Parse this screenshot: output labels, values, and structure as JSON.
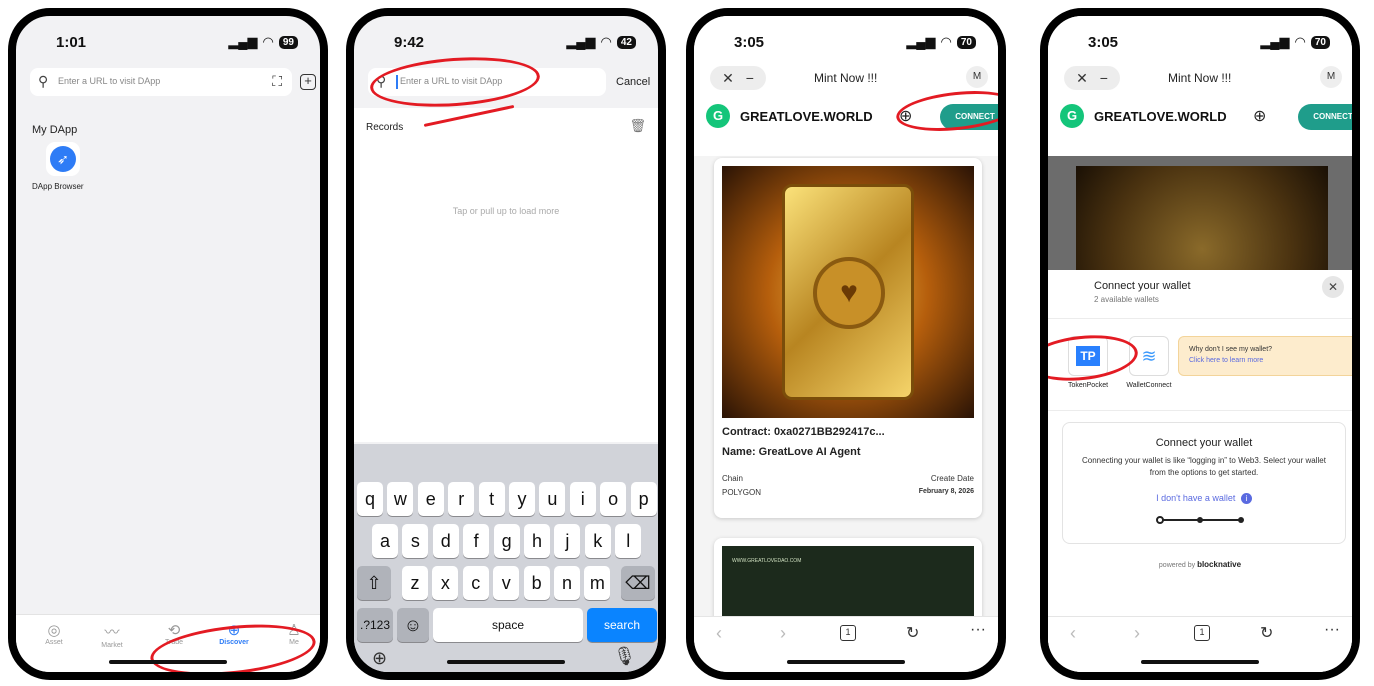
{
  "phone1": {
    "time": "1:01",
    "battery": "99",
    "search_placeholder": "Enter a URL to visit DApp",
    "section_title": "My DApp",
    "dapp_label": "DApp Browser",
    "tabs": [
      "Asset",
      "Market",
      "Trade",
      "Discover",
      "Me"
    ]
  },
  "phone2": {
    "time": "9:42",
    "battery": "42",
    "search_placeholder": "Enter a URL to visit DApp",
    "cancel": "Cancel",
    "records": "Records",
    "load_more": "Tap or pull up to load more",
    "keys_row1": [
      "q",
      "w",
      "e",
      "r",
      "t",
      "y",
      "u",
      "i",
      "o",
      "p"
    ],
    "keys_row2": [
      "a",
      "s",
      "d",
      "f",
      "g",
      "h",
      "j",
      "k",
      "l"
    ],
    "keys_row3": [
      "z",
      "x",
      "c",
      "v",
      "b",
      "n",
      "m"
    ],
    "key_123": ".?123",
    "key_space": "space",
    "key_search": "search"
  },
  "phone3": {
    "time": "3:05",
    "battery": "70",
    "title": "Mint Now !!!",
    "avatar": "M",
    "site_name": "GREATLOVE.WORLD",
    "connect": "CONNECT",
    "contract": "Contract: 0xa0271BB292417c...",
    "name": "Name: GreatLove AI Agent",
    "chain_label": "Chain",
    "chain_value": "POLYGON",
    "date_label": "Create Date",
    "date_value": "February 8, 2026",
    "second_card_url": "WWW.GREATLOVEDAO.COM",
    "tab_count": "1"
  },
  "phone4": {
    "time": "3:05",
    "battery": "70",
    "title": "Mint Now !!!",
    "avatar": "M",
    "site_name": "GREATLOVE.WORLD",
    "connect": "CONNECT",
    "modal_title": "Connect your wallet",
    "modal_sub": "2 available wallets",
    "wallet1": "TokenPocket",
    "wallet1_logo": "TP",
    "wallet2": "WalletConnect",
    "why_title": "Why don't I see my wallet?",
    "why_link": "Click here to learn more",
    "info_title": "Connect your wallet",
    "info_text": "Connecting your wallet is like “logging in” to Web3. Select your wallet from the options to get started.",
    "no_wallet": "I don't have a wallet",
    "powered_by": "powered by",
    "brand": "blocknative",
    "tab_count": "1"
  },
  "colors": {
    "accent_blue": "#2e7cf6",
    "teal": "#1f9d8b",
    "annotation_red": "#e31b23",
    "tp_blue": "#2980fe"
  }
}
